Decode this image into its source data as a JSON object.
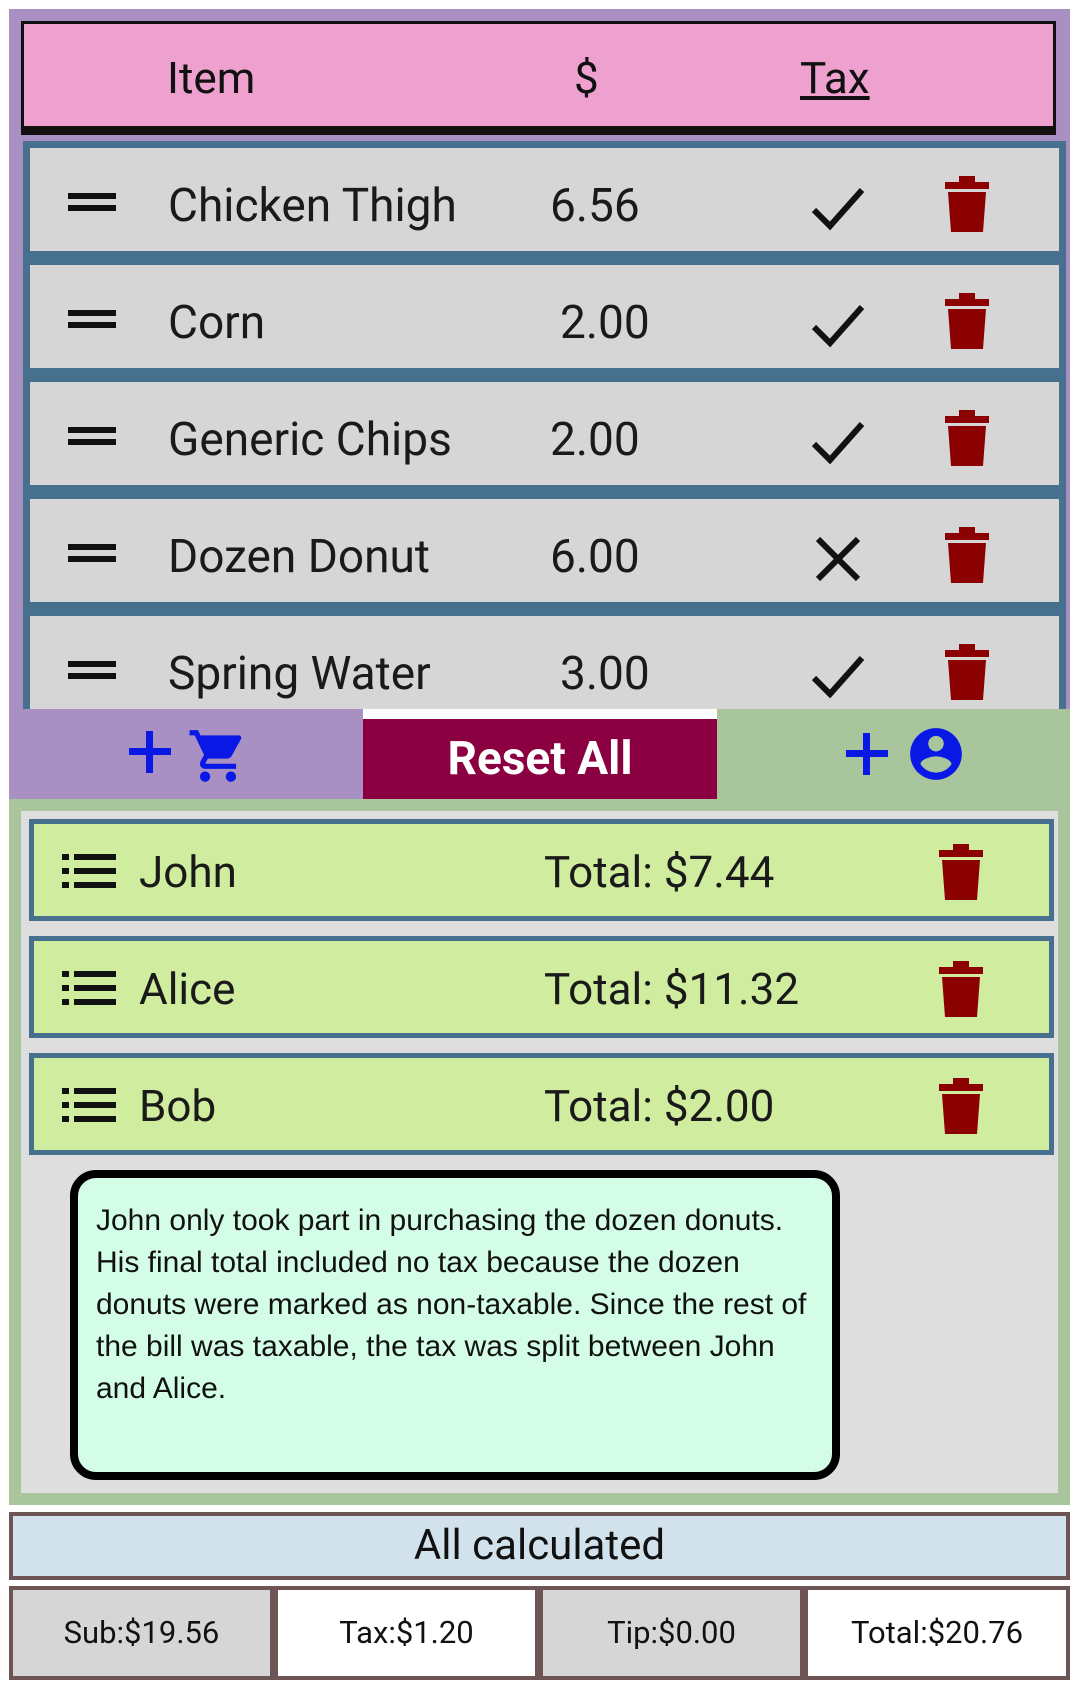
{
  "items_header": {
    "item": "Item",
    "price": "$",
    "tax": "Tax"
  },
  "items": [
    {
      "name": "Chicken Thigh",
      "price": "6.56",
      "taxable": true
    },
    {
      "name": "Corn",
      "price": "2.00",
      "taxable": true
    },
    {
      "name": "Generic Chips",
      "price": "2.00",
      "taxable": true
    },
    {
      "name": "Dozen Donut",
      "price": "6.00",
      "taxable": false
    },
    {
      "name": "Spring Water",
      "price": "3.00",
      "taxable": true
    }
  ],
  "toolbar": {
    "reset_label": "Reset All"
  },
  "people": [
    {
      "name": "John",
      "total": "Total: $7.44"
    },
    {
      "name": "Alice",
      "total": "Total: $11.32"
    },
    {
      "name": "Bob",
      "total": "Total: $2.00"
    }
  ],
  "note": "John only took part in purchasing the dozen donuts. His final total included no tax because the dozen donuts were marked as non-taxable. Since the rest of the bill was taxable, the tax was split between John and Alice.",
  "status": "All calculated",
  "totals": {
    "sub": "Sub:$19.56",
    "tax": "Tax:$1.20",
    "tip": "Tip:$0.00",
    "total": "Total:$20.76"
  },
  "colors": {
    "items_bg": "#a890c2",
    "header_pink": "#eea0ce",
    "row_border": "#46708e",
    "people_bg": "#a8c59b",
    "person_row": "#d0ec9e",
    "reset_bg": "#8a0040",
    "trash": "#8b0000",
    "add_blue": "#0a18e6",
    "note_bg": "#d4fde7"
  }
}
